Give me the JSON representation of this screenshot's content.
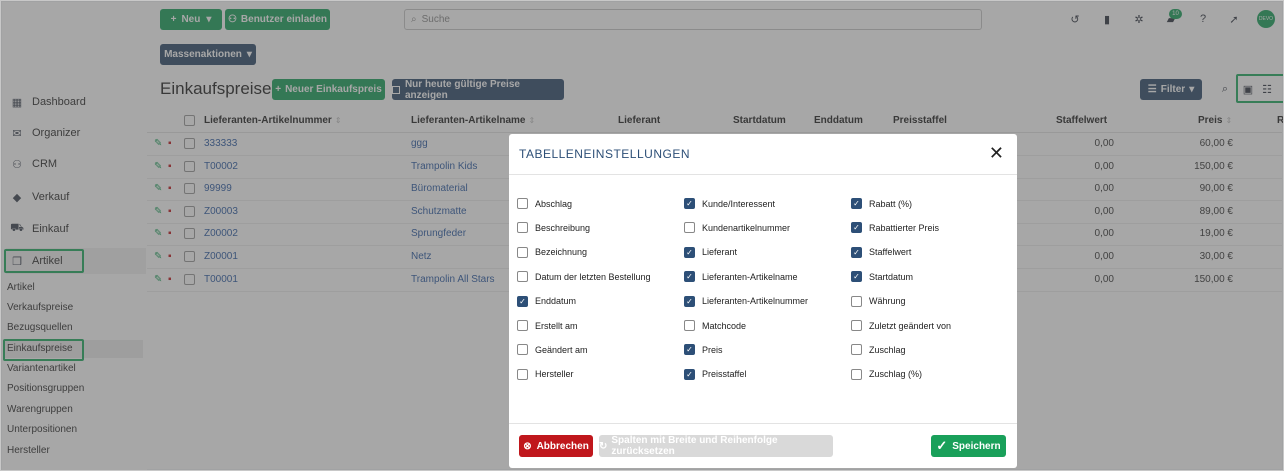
{
  "topbar": {
    "new_label": "Neu",
    "invite_label": "Benutzer einladen",
    "search_placeholder": "Suche",
    "chat_badge": "10",
    "avatar_text": "DEVO"
  },
  "bulk_actions_label": "Massenaktionen",
  "page": {
    "title": "Einkaufspreise",
    "new_price_label": "Neuer Einkaufspreis",
    "today_label": "Nur heute gültige Preise anzeigen",
    "filter_label": "Filter"
  },
  "sidebar": {
    "items": [
      {
        "label": "Dashboard",
        "icon": "dashboard-icon"
      },
      {
        "label": "Organizer",
        "icon": "envelope-icon"
      },
      {
        "label": "CRM",
        "icon": "users-icon"
      },
      {
        "label": "Verkauf",
        "icon": "tag-icon"
      },
      {
        "label": "Einkauf",
        "icon": "cart-icon"
      },
      {
        "label": "Artikel",
        "icon": "box-icon"
      }
    ],
    "subitems": [
      "Artikel",
      "Verkaufspreise",
      "Bezugsquellen",
      "Einkaufspreise",
      "Variantenartikel",
      "Positionsgruppen",
      "Warengruppen",
      "Unterpositionen",
      "Hersteller"
    ]
  },
  "table": {
    "headers": [
      "Lieferanten-Artikelnummer",
      "Lieferanten-Artikelname",
      "Lieferant",
      "Startdatum",
      "Enddatum",
      "Preisstaffel",
      "Staffelwert",
      "Preis",
      "R"
    ],
    "rows": [
      {
        "nr": "333333",
        "name": "ggg",
        "staffelwert": "0,00",
        "preis": "60,00 €"
      },
      {
        "nr": "T00002",
        "name": "Trampolin Kids",
        "staffelwert": "0,00",
        "preis": "150,00 €"
      },
      {
        "nr": "99999",
        "name": "Büromaterial",
        "staffelwert": "0,00",
        "preis": "90,00 €"
      },
      {
        "nr": "Z00003",
        "name": "Schutzmatte",
        "staffelwert": "0,00",
        "preis": "89,00 €"
      },
      {
        "nr": "Z00002",
        "name": "Sprungfeder",
        "staffelwert": "0,00",
        "preis": "19,00 €"
      },
      {
        "nr": "Z00001",
        "name": "Netz",
        "staffelwert": "0,00",
        "preis": "30,00 €"
      },
      {
        "nr": "T00001",
        "name": "Trampolin All Stars",
        "staffelwert": "0,00",
        "preis": "150,00 €"
      }
    ]
  },
  "modal": {
    "title": "TABELLENEINSTELLUNGEN",
    "options": [
      {
        "label": "Abschlag",
        "checked": false
      },
      {
        "label": "Beschreibung",
        "checked": false
      },
      {
        "label": "Bezeichnung",
        "checked": false
      },
      {
        "label": "Datum der letzten Bestellung",
        "checked": false
      },
      {
        "label": "Enddatum",
        "checked": true
      },
      {
        "label": "Erstellt am",
        "checked": false
      },
      {
        "label": "Geändert am",
        "checked": false
      },
      {
        "label": "Hersteller",
        "checked": false
      },
      {
        "label": "Kunde/Interessent",
        "checked": true
      },
      {
        "label": "Kundenartikelnummer",
        "checked": false
      },
      {
        "label": "Lieferant",
        "checked": true
      },
      {
        "label": "Lieferanten-Artikelname",
        "checked": true
      },
      {
        "label": "Lieferanten-Artikelnummer",
        "checked": true
      },
      {
        "label": "Matchcode",
        "checked": false
      },
      {
        "label": "Preis",
        "checked": true
      },
      {
        "label": "Preisstaffel",
        "checked": true
      },
      {
        "label": "Rabatt (%)",
        "checked": true
      },
      {
        "label": "Rabattierter Preis",
        "checked": true
      },
      {
        "label": "Staffelwert",
        "checked": true
      },
      {
        "label": "Startdatum",
        "checked": true
      },
      {
        "label": "Währung",
        "checked": false
      },
      {
        "label": "Zuletzt geändert von",
        "checked": false
      },
      {
        "label": "Zuschlag",
        "checked": false
      },
      {
        "label": "Zuschlag (%)",
        "checked": false
      }
    ],
    "cancel_label": "Abbrechen",
    "reset_label": "Spalten mit Breite und Reihenfolge zurücksetzen",
    "save_label": "Speichern"
  },
  "colors": {
    "green": "#19a05a",
    "navy": "#2f4a6b",
    "cancel_red": "#c0171c",
    "highlight_green": "#1faa5f"
  }
}
